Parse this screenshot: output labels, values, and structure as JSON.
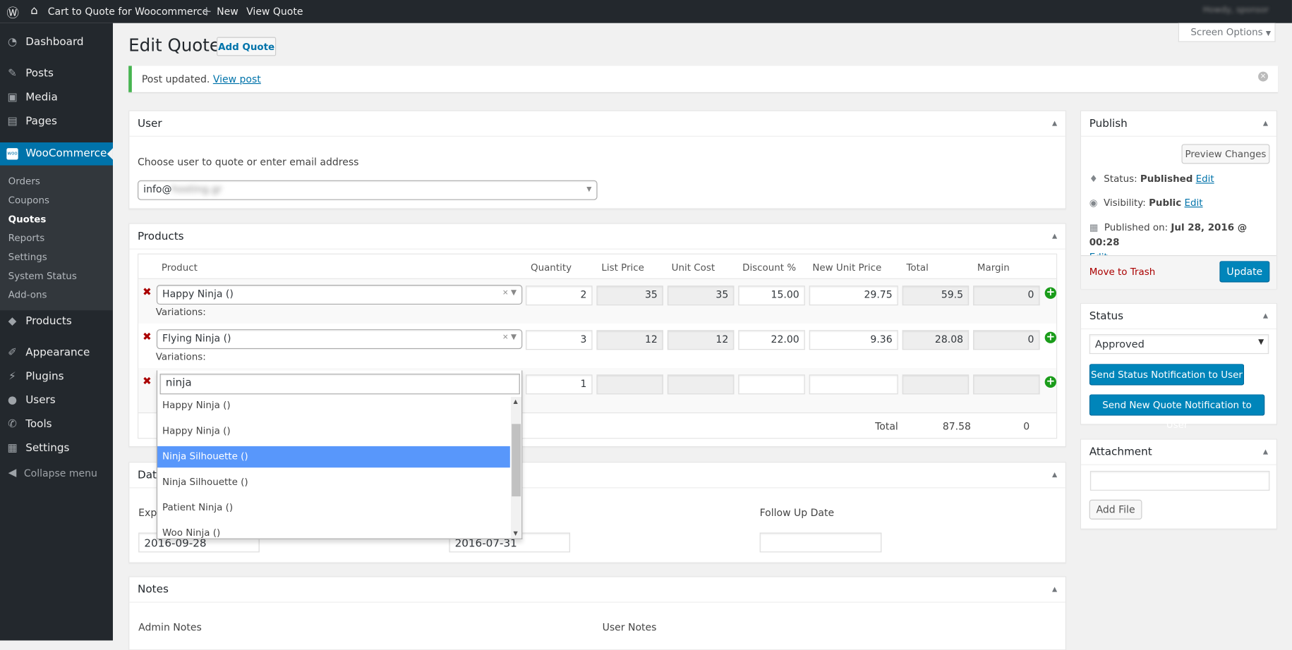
{
  "adminbar": {
    "site": "Cart to Quote for Woocommerce",
    "new": "New",
    "view": "View Quote",
    "account": "Howdy, sponsor"
  },
  "sidebar": {
    "items": [
      {
        "label": "Dashboard",
        "icon": "dashboard-icon"
      },
      {
        "label": "Posts",
        "icon": "pin-icon"
      },
      {
        "label": "Media",
        "icon": "media-icon"
      },
      {
        "label": "Pages",
        "icon": "pages-icon"
      },
      {
        "label": "WooCommerce",
        "icon": "woo-icon"
      },
      {
        "label": "Products",
        "icon": "products-icon"
      },
      {
        "label": "Appearance",
        "icon": "brush-icon"
      },
      {
        "label": "Plugins",
        "icon": "plugin-icon"
      },
      {
        "label": "Users",
        "icon": "user-icon"
      },
      {
        "label": "Tools",
        "icon": "wrench-icon"
      },
      {
        "label": "Settings",
        "icon": "settings-icon"
      }
    ],
    "submenu": [
      "Orders",
      "Coupons",
      "Quotes",
      "Reports",
      "Settings",
      "System Status",
      "Add-ons"
    ],
    "collapse": "Collapse menu"
  },
  "header": {
    "title": "Edit Quote",
    "add": "Add Quote",
    "screen_options": "Screen Options"
  },
  "notice": {
    "text": "Post updated.",
    "link": "View post"
  },
  "user_box": {
    "title": "User",
    "label": "Choose user to quote or enter email address",
    "value": "info@"
  },
  "products": {
    "title": "Products",
    "columns": [
      "Product",
      "Quantity",
      "List Price",
      "Unit Cost",
      "Discount %",
      "New Unit Price",
      "Total",
      "Margin"
    ],
    "variations_label": "Variations:",
    "rows": [
      {
        "product": "Happy Ninja ()",
        "qty": "2",
        "list": "35",
        "cost": "35",
        "discount": "15.00",
        "new_price": "29.75",
        "total": "59.5",
        "margin": "0"
      },
      {
        "product": "Flying Ninja ()",
        "qty": "3",
        "list": "12",
        "cost": "12",
        "discount": "22.00",
        "new_price": "9.36",
        "total": "28.08",
        "margin": "0"
      },
      {
        "product": "",
        "qty": "1",
        "list": "",
        "cost": "",
        "discount": "",
        "new_price": "",
        "total": "",
        "margin": ""
      }
    ],
    "total_label": "Total",
    "total": "87.58",
    "total_margin": "0",
    "search": "ninja",
    "options": [
      "Happy Ninja ()",
      "Happy Ninja ()",
      "Ninja Silhouette ()",
      "Ninja Silhouette ()",
      "Patient Ninja ()",
      "Woo Ninja ()"
    ],
    "highlighted": "Ninja Silhouette ()"
  },
  "dates": {
    "title": "Dates",
    "expiry_label": "Expiry Date",
    "expiry": "2016-09-28",
    "second": "2016-07-31",
    "followup_label": "Follow Up Date",
    "followup": ""
  },
  "notes": {
    "title": "Notes",
    "admin": "Admin Notes",
    "user": "User Notes"
  },
  "publish": {
    "title": "Publish",
    "preview": "Preview Changes",
    "status_label": "Status:",
    "status": "Published",
    "visibility_label": "Visibility:",
    "visibility": "Public",
    "published_label": "Published on:",
    "published": "Jul 28, 2016 @ 00:28",
    "edit": "Edit",
    "trash": "Move to Trash",
    "update": "Update"
  },
  "status_box": {
    "title": "Status",
    "value": "Approved",
    "notify": "Send Status Notification to User",
    "new_quote": "Send New Quote Notification to User"
  },
  "attachment": {
    "title": "Attachment",
    "add": "Add File"
  },
  "colors": {
    "accent": "#0073aa",
    "button": "#0085ba",
    "highlight": "#5897fb",
    "notice": "#46b450",
    "delete": "#aa0000",
    "add": "#1a9c1a"
  }
}
